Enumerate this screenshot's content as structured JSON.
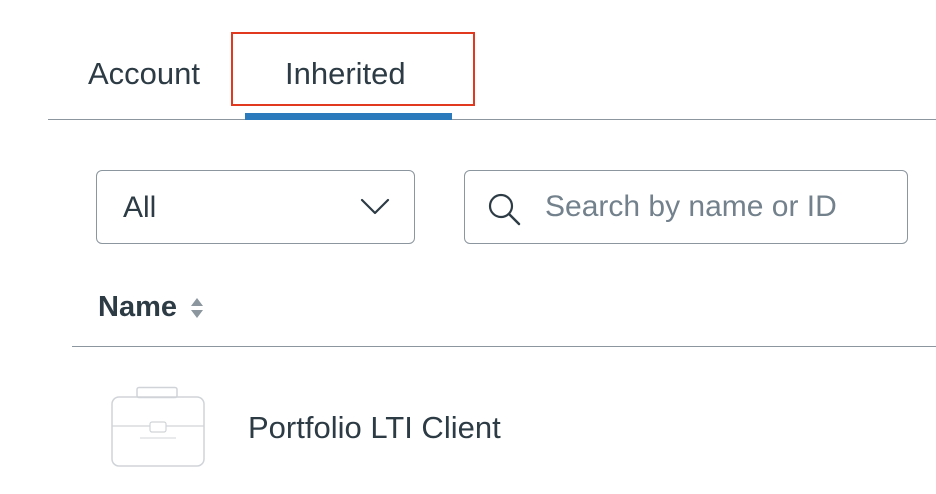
{
  "tabs": {
    "account": "Account",
    "inherited": "Inherited",
    "active": "inherited"
  },
  "filter": {
    "selected": "All"
  },
  "search": {
    "placeholder": "Search by name or ID",
    "value": ""
  },
  "table": {
    "columns": [
      {
        "label": "Name",
        "sortable": true
      }
    ],
    "rows": [
      {
        "name": "Portfolio LTI Client",
        "icon": "briefcase-icon"
      }
    ]
  },
  "colors": {
    "text": "#2d3b45",
    "active_tab_underline": "#2b7abc",
    "highlight_box": "#e0391f",
    "border": "#8b969e",
    "placeholder": "#73818c"
  }
}
